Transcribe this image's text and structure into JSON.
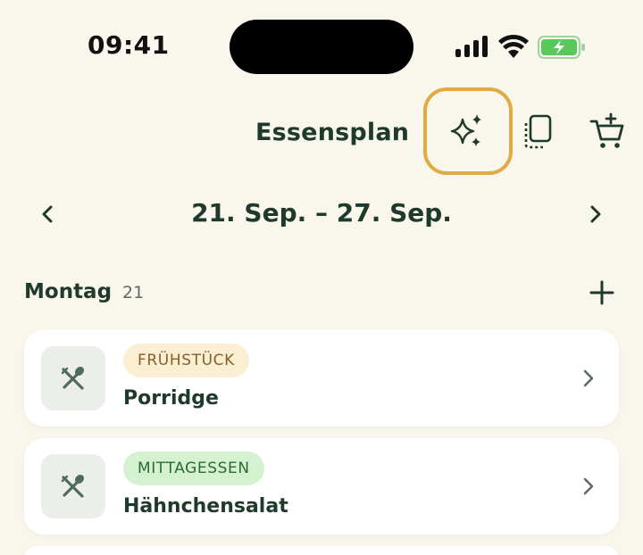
{
  "status_bar": {
    "time": "09:41",
    "icons": [
      "cellular-signal-icon",
      "wifi-icon",
      "battery-charging-icon"
    ],
    "battery_color": "#5ac85a"
  },
  "header": {
    "title": "Essensplan",
    "actions": [
      "sparkles-icon",
      "copy-icon",
      "cart-add-icon"
    ],
    "highlight_color": "#e0aa44"
  },
  "week": {
    "label": "21. Sep. – 27. Sep.",
    "prev_icon": "chevron-left-icon",
    "next_icon": "chevron-right-icon"
  },
  "day": {
    "name": "Montag",
    "number": "21",
    "add_icon": "plus-icon"
  },
  "meals": [
    {
      "tag": "FRÜHSTÜCK",
      "name": "Porridge",
      "tag_bg": "#fbeed3",
      "tag_color": "#83622a",
      "icon": "utensils-icon"
    },
    {
      "tag": "MITTAGESSEN",
      "name": "Hähnchensalat",
      "tag_bg": "#d4f2cf",
      "tag_color": "#2d6a34",
      "icon": "utensils-icon"
    }
  ],
  "colors": {
    "background": "#f9f6ec",
    "primary_text": "#1f3a2c",
    "card": "#ffffff"
  }
}
